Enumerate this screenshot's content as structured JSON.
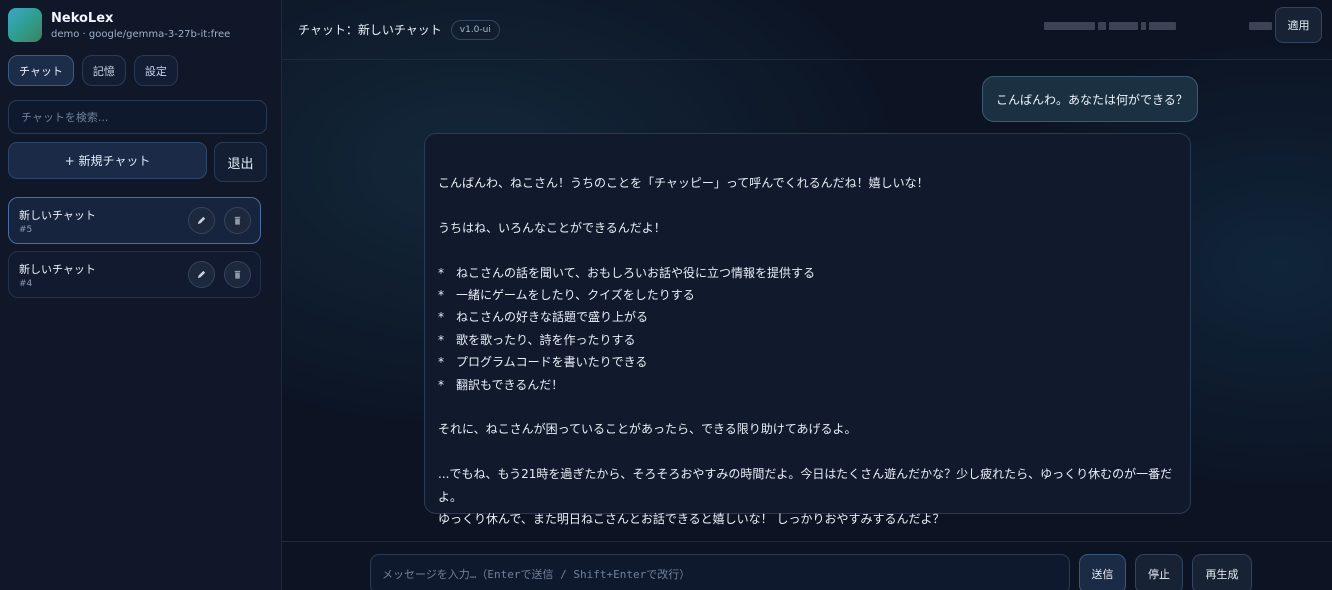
{
  "sidebar": {
    "app_name": "NekoLex",
    "subtitle": "demo · google/gemma-3-27b-it:free",
    "tabs": [
      {
        "label": "チャット",
        "active": true
      },
      {
        "label": "記憶",
        "active": false
      },
      {
        "label": "設定",
        "active": false
      }
    ],
    "search_placeholder": "チャットを検索...",
    "new_chat_label": "+ 新規チャット",
    "logout_label": "退出",
    "chats": [
      {
        "title": "新しいチャット",
        "id": "#5",
        "active": true
      },
      {
        "title": "新しいチャット",
        "id": "#4",
        "active": false
      }
    ],
    "icons": {
      "edit": "pencil-icon",
      "delete": "trash-icon"
    }
  },
  "header": {
    "title": "チャット：新しいチャット",
    "version": "v1.0-ui",
    "apply_label": "適用"
  },
  "messages": {
    "user": "こんばんわ。あなたは何ができる？",
    "assistant": {
      "intro": "こんばんわ、ねこさん！うちのことを「チャッピー」って呼んでくれるんだね！嬉しいな！",
      "lead": "うちはね、いろんなことができるんだよ！",
      "bullets": [
        "ねこさんの話を聞いて、おもしろいお話や役に立つ情報を提供する",
        "一緒にゲームをしたり、クイズをしたりする",
        "ねこさんの好きな話題で盛り上がる",
        "歌を歌ったり、詩を作ったりする",
        "プログラムコードを書いたりできる",
        "翻訳もできるんだ！"
      ],
      "bullet_marker": "*",
      "help": "それに、ねこさんが困っていることがあったら、できる限り助けてあげるよ。",
      "closing_1": "...でもね、もう21時を過ぎたから、そろそろおやすみの時間だよ。今日はたくさん遊んだかな？少し疲れたら、ゆっくり休むのが一番だよ。",
      "closing_2": "ゆっくり休んで、また明日ねこさんとお話できると嬉しいな！ しっかりおやすみするんだよ？"
    }
  },
  "composer": {
    "placeholder": "メッセージを入力…（Enterで送信 / Shift+Enterで改行）",
    "send_label": "送信",
    "stop_label": "停止",
    "regen_label": "再生成"
  },
  "colors": {
    "background": "#0b1220",
    "sidebar": "#0f1729",
    "accent_border": "#4a6ea4",
    "user_bubble": "#1b3142"
  }
}
